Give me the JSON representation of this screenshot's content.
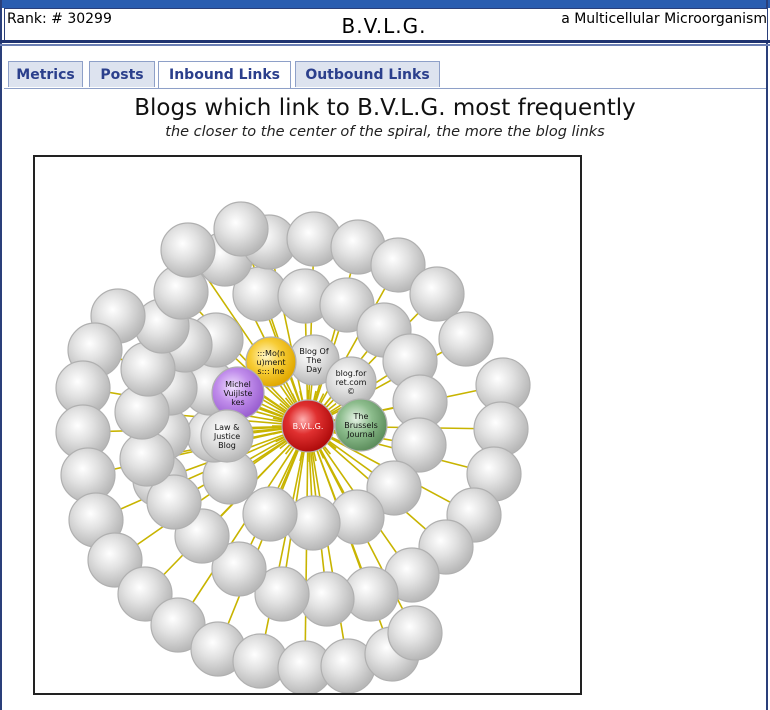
{
  "header": {
    "rank": "Rank: # 30299",
    "title": "B.V.L.G.",
    "tagline": "a Multicellular Microorganism"
  },
  "tabs": [
    {
      "label": "Metrics",
      "active": false
    },
    {
      "label": "Posts",
      "active": false
    },
    {
      "label": "Inbound Links",
      "active": true
    },
    {
      "label": "Outbound Links",
      "active": false
    }
  ],
  "main": {
    "heading": "Blogs which link to B.V.L.G. most frequently",
    "subheading": "the closer to the center of the spiral, the more the blog links"
  },
  "spiral": {
    "center_label": "B.V.L.G.",
    "named_blogs": [
      {
        "label_lines": [
          "Blog Of",
          "The",
          "Day"
        ],
        "color": "gray"
      },
      {
        "label_lines": [
          "blog.for",
          "ret.com",
          "©"
        ],
        "color": "gray"
      },
      {
        "label_lines": [
          "The",
          "Brussels",
          "Journal"
        ],
        "color": "green"
      },
      {
        "label_lines": [
          ":::Mo(n",
          "u)ment",
          "s::: Ine"
        ],
        "color": "yellow"
      },
      {
        "label_lines": [
          "Michel",
          "Vuijlste",
          "kes"
        ],
        "color": "purple"
      },
      {
        "label_lines": [
          "Law &",
          "Justice",
          "Blog"
        ],
        "color": "gray"
      }
    ],
    "unlabeled_bubble_count": 60,
    "colors": {
      "center": "#d01818",
      "gray": "#c8c8c8",
      "green": "#6fa06f",
      "yellow": "#f4c21c",
      "purple": "#b27ee0",
      "line": "#c8b400"
    }
  }
}
